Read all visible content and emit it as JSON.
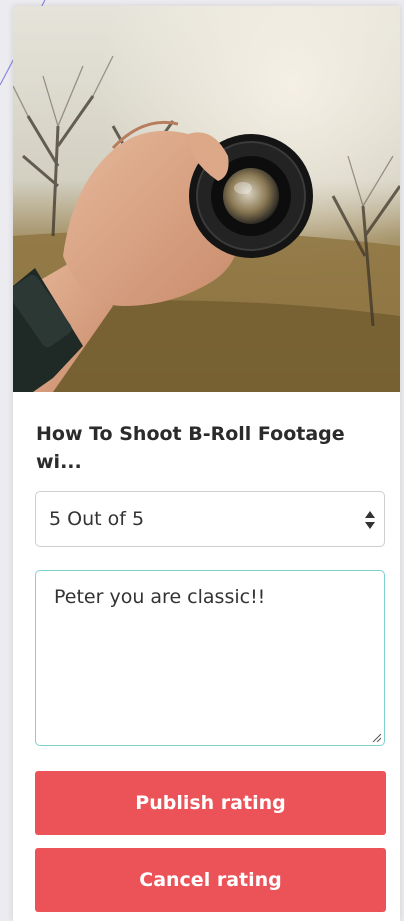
{
  "card": {
    "title": "How To Shoot B-Roll Footage wi..."
  },
  "rating_select": {
    "selected": "5 Out of 5"
  },
  "review": {
    "value": "Peter you are classic!!"
  },
  "buttons": {
    "publish_label": "Publish rating",
    "cancel_label": "Cancel rating"
  },
  "colors": {
    "button": "#ec5358",
    "focus_border": "#7fd1cf",
    "background": "#ececf0"
  }
}
